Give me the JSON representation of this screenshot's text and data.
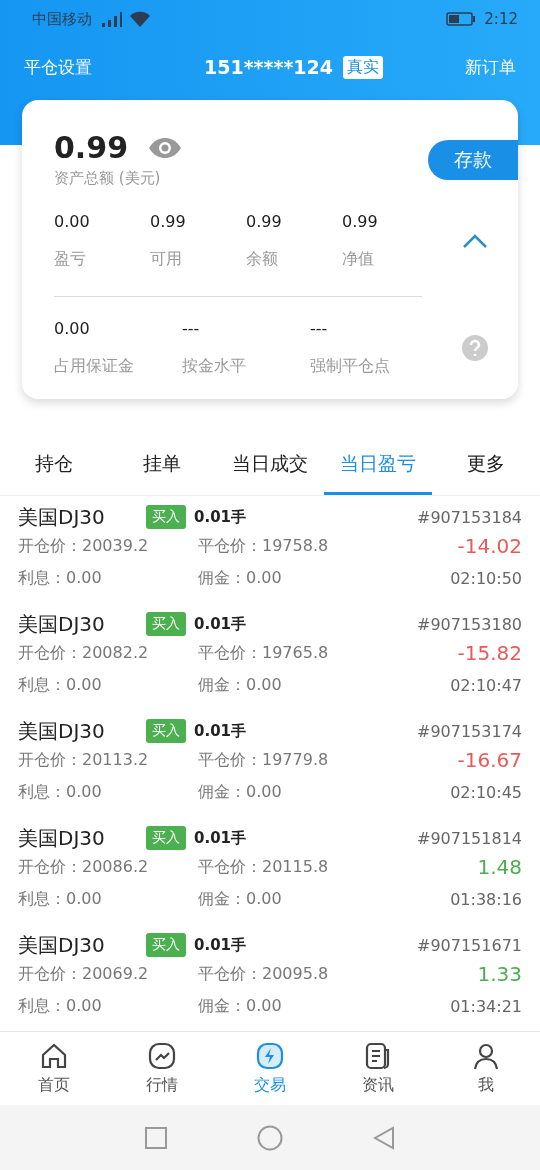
{
  "status_bar": {
    "carrier": "中国移动",
    "time": "2:12"
  },
  "header": {
    "left": "平仓设置",
    "account": "151*****124",
    "account_type": "真实",
    "right": "新订单"
  },
  "summary": {
    "balance": "0.99",
    "balance_label": "资产总额 (美元)",
    "deposit_button": "存款",
    "expanded": true,
    "stats": [
      {
        "value": "0.00",
        "label": "盈亏"
      },
      {
        "value": "0.99",
        "label": "可用"
      },
      {
        "value": "0.99",
        "label": "余额"
      },
      {
        "value": "0.99",
        "label": "净值"
      }
    ],
    "margin_stats": [
      {
        "value": "0.00",
        "label": "占用保证金"
      },
      {
        "value": "---",
        "label": "按金水平"
      },
      {
        "value": "---",
        "label": "强制平仓点"
      }
    ]
  },
  "tabs": [
    {
      "label": "持仓",
      "selected": false
    },
    {
      "label": "挂单",
      "selected": false
    },
    {
      "label": "当日成交",
      "selected": false
    },
    {
      "label": "当日盈亏",
      "selected": true
    },
    {
      "label": "更多",
      "selected": false
    }
  ],
  "trades": [
    {
      "symbol": "美国DJ30",
      "side": "买入",
      "lots": "0.01手",
      "ticket": "#907153184",
      "open_price": "开仓价：20039.2",
      "close_price": "平仓价：19758.8",
      "profit": "-14.02",
      "color": "#e85a5a",
      "interest": "利息：0.00",
      "commission": "佣金：0.00",
      "time": "02:10:50"
    },
    {
      "symbol": "美国DJ30",
      "side": "买入",
      "lots": "0.01手",
      "ticket": "#907153180",
      "open_price": "开仓价：20082.2",
      "close_price": "平仓价：19765.8",
      "profit": "-15.82",
      "color": "#e85a5a",
      "interest": "利息：0.00",
      "commission": "佣金：0.00",
      "time": "02:10:47"
    },
    {
      "symbol": "美国DJ30",
      "side": "买入",
      "lots": "0.01手",
      "ticket": "#907153174",
      "open_price": "开仓价：20113.2",
      "close_price": "平仓价：19779.8",
      "profit": "-16.67",
      "color": "#e85a5a",
      "interest": "利息：0.00",
      "commission": "佣金：0.00",
      "time": "02:10:45"
    },
    {
      "symbol": "美国DJ30",
      "side": "买入",
      "lots": "0.01手",
      "ticket": "#907151814",
      "open_price": "开仓价：20086.2",
      "close_price": "平仓价：20115.8",
      "profit": "1.48",
      "color": "#4cae50",
      "interest": "利息：0.00",
      "commission": "佣金：0.00",
      "time": "01:38:16"
    },
    {
      "symbol": "美国DJ30",
      "side": "买入",
      "lots": "0.01手",
      "ticket": "#907151671",
      "open_price": "开仓价：20069.2",
      "close_price": "平仓价：20095.8",
      "profit": "1.33",
      "color": "#4cae50",
      "interest": "利息：0.00",
      "commission": "佣金：0.00",
      "time": "01:34:21"
    }
  ],
  "bottom_nav": [
    {
      "kind": "home",
      "label": "首页",
      "selected": false
    },
    {
      "kind": "market",
      "label": "行情",
      "selected": false
    },
    {
      "kind": "trade",
      "label": "交易",
      "selected": true
    },
    {
      "kind": "news",
      "label": "资讯",
      "selected": false
    },
    {
      "kind": "me",
      "label": "我",
      "selected": false
    }
  ]
}
